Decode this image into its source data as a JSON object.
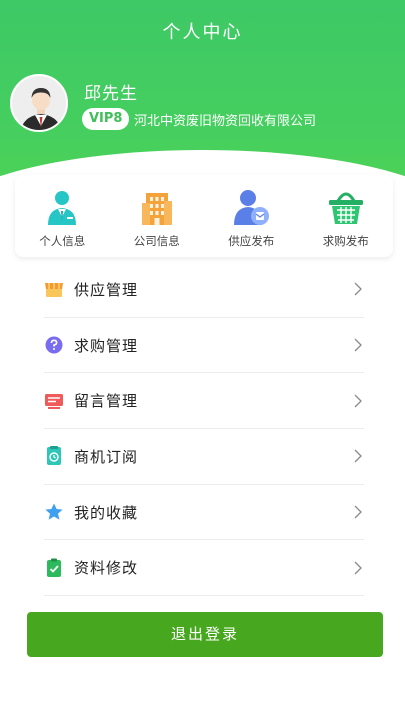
{
  "header": {
    "title": "个人中心"
  },
  "profile": {
    "name": "邱先生",
    "vip": "VIP8",
    "company": "河北中资废旧物资回收有限公司"
  },
  "quick_actions": [
    {
      "label": "个人信息",
      "icon": "person-tie-icon"
    },
    {
      "label": "公司信息",
      "icon": "building-icon"
    },
    {
      "label": "供应发布",
      "icon": "user-publish-icon"
    },
    {
      "label": "求购发布",
      "icon": "basket-icon"
    }
  ],
  "menu": [
    {
      "label": "供应管理",
      "icon": "shop-awning-icon"
    },
    {
      "label": "求购管理",
      "icon": "question-bubble-icon"
    },
    {
      "label": "留言管理",
      "icon": "message-board-icon"
    },
    {
      "label": "商机订阅",
      "icon": "subscription-icon"
    },
    {
      "label": "我的收藏",
      "icon": "star-icon"
    },
    {
      "label": "资料修改",
      "icon": "clipboard-check-icon"
    }
  ],
  "logout_label": "退出登录",
  "colors": {
    "header_green": "#46cf5f",
    "button_green": "#47a820",
    "vip_text": "#3fbf57"
  }
}
